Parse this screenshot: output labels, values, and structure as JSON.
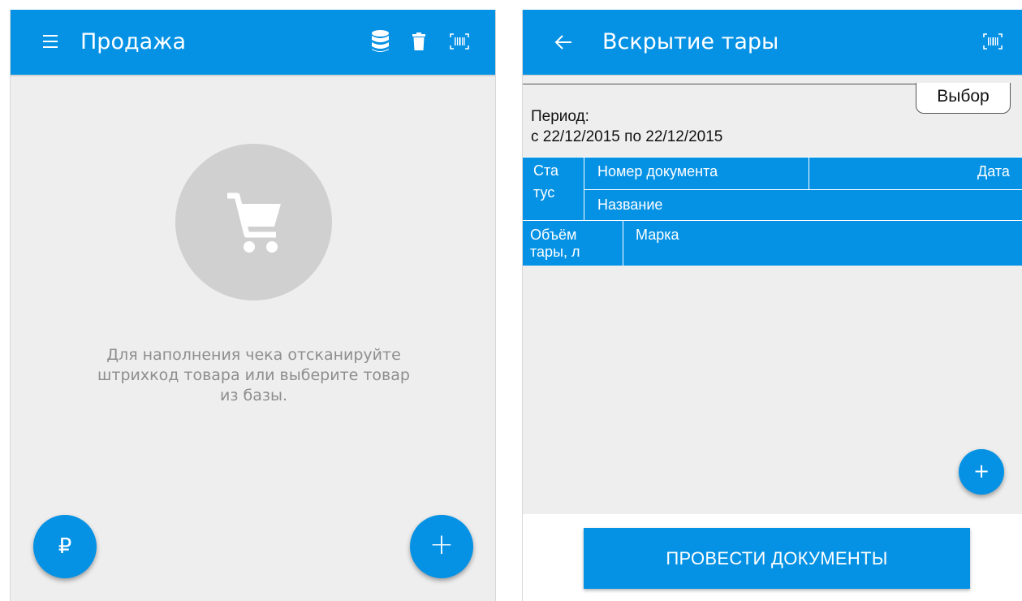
{
  "sale_screen": {
    "title": "Продажа",
    "icons": [
      "menu-icon",
      "database-icon",
      "trash-icon",
      "barcode-scan-icon"
    ],
    "empty_icon": "cart-icon",
    "empty_text_line1": "Для наполнения чека отсканируйте",
    "empty_text_line2": "штрихкод товара или выберите товар",
    "empty_text_line3": "из базы.",
    "pay_button_label": "₽",
    "add_button_label": "+"
  },
  "open_container_screen": {
    "title": "Вскрытие тары",
    "icons": [
      "back-arrow-icon",
      "barcode-scan-icon"
    ],
    "select_tab_label": "Выбор",
    "period_label": "Период:",
    "period_value": "с 22/12/2015 по 22/12/2015",
    "table_header": {
      "status_line1": "Ста",
      "status_line2": "тус",
      "doc_number": "Номер документа",
      "date": "Дата",
      "name": "Название",
      "volume_line1": "Объём",
      "volume_line2": "тары, л",
      "brand": "Марка"
    },
    "add_button_label": "+",
    "post_button_label": "ПРОВЕСТИ ДОКУМЕНТЫ"
  },
  "colors": {
    "primary": "#0592e5",
    "background": "#eeeeee",
    "empty_state_circle": "#d0d0d0",
    "empty_state_text": "#8e8e8e"
  }
}
